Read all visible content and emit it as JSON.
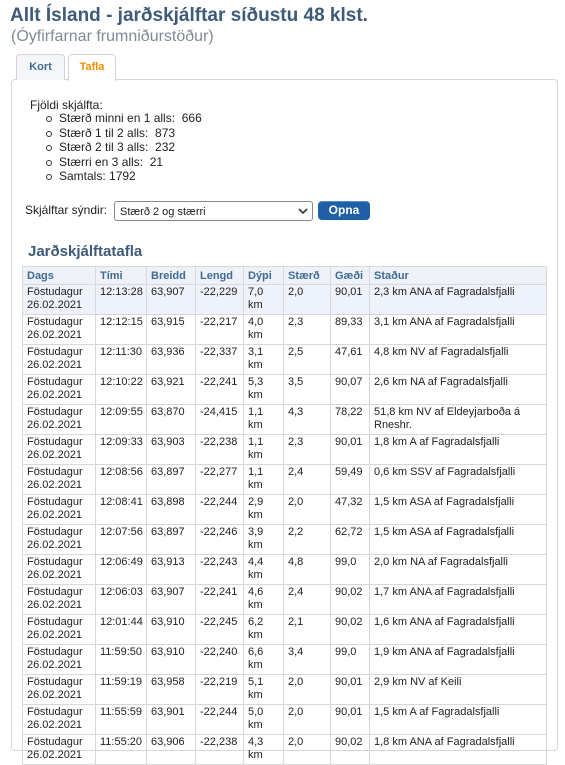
{
  "header": {
    "title": "Allt Ísland - jarðskjálftar síðustu 48 klst.",
    "subtitle": "(Óyfirfarnar frumniðurstöður)"
  },
  "tabs": [
    {
      "label": "Kort",
      "active": false
    },
    {
      "label": "Tafla",
      "active": true
    }
  ],
  "counts": {
    "title": "Fjöldi skjálfta:",
    "items": [
      {
        "label": "Stærð minni en 1 alls:  666"
      },
      {
        "label": "Stærð 1 til 2 alls:  873"
      },
      {
        "label": "Stærð 2 til 3 alls:  232"
      },
      {
        "label": "Stærri en 3 alls:  21"
      },
      {
        "label": "Samtals: 1792"
      }
    ]
  },
  "filter": {
    "label": "Skjálftar sýndir:",
    "selected": "Stærð 2 og stærri",
    "button_label": "Opna"
  },
  "table": {
    "title": "Jarðskjálftatafla",
    "columns": [
      "Dags",
      "Tími",
      "Breidd",
      "Lengd",
      "Dýpi",
      "Stærð",
      "Gæði",
      "Staður"
    ],
    "rows": [
      {
        "day": "Föstudagur",
        "date": "26.02.2021",
        "time": "12:13:28",
        "lat": "63,907",
        "lon": "-22,229",
        "depth": "7,0",
        "depth_unit": "km",
        "mag": "2,0",
        "quality": "90,01",
        "place": "2,3 km ANA af Fagradalsfjalli"
      },
      {
        "day": "Föstudagur",
        "date": "26.02.2021",
        "time": "12:12:15",
        "lat": "63,915",
        "lon": "-22,217",
        "depth": "4,0",
        "depth_unit": "km",
        "mag": "2,3",
        "quality": "89,33",
        "place": "3,1 km ANA af Fagradalsfjalli"
      },
      {
        "day": "Föstudagur",
        "date": "26.02.2021",
        "time": "12:11:30",
        "lat": "63,936",
        "lon": "-22,337",
        "depth": "3,1",
        "depth_unit": "km",
        "mag": "2,5",
        "quality": "47,61",
        "place": "4,8 km NV af Fagradalsfjalli"
      },
      {
        "day": "Föstudagur",
        "date": "26.02.2021",
        "time": "12:10:22",
        "lat": "63,921",
        "lon": "-22,241",
        "depth": "5,3",
        "depth_unit": "km",
        "mag": "3,5",
        "quality": "90,07",
        "place": "2,6 km NA af Fagradalsfjalli"
      },
      {
        "day": "Föstudagur",
        "date": "26.02.2021",
        "time": "12:09:55",
        "lat": "63,870",
        "lon": "-24,415",
        "depth": "1,1",
        "depth_unit": "km",
        "mag": "4,3",
        "quality": "78,22",
        "place": "51,8 km NV af Eldeyjarboða á Rneshr."
      },
      {
        "day": "Föstudagur",
        "date": "26.02.2021",
        "time": "12:09:33",
        "lat": "63,903",
        "lon": "-22,238",
        "depth": "1,1",
        "depth_unit": "km",
        "mag": "2,3",
        "quality": "90,01",
        "place": "1,8 km A af Fagradalsfjalli"
      },
      {
        "day": "Föstudagur",
        "date": "26.02.2021",
        "time": "12:08:56",
        "lat": "63,897",
        "lon": "-22,277",
        "depth": "1,1",
        "depth_unit": "km",
        "mag": "2,4",
        "quality": "59,49",
        "place": "0,6 km SSV af Fagradalsfjalli"
      },
      {
        "day": "Föstudagur",
        "date": "26.02.2021",
        "time": "12:08:41",
        "lat": "63,898",
        "lon": "-22,244",
        "depth": "2,9",
        "depth_unit": "km",
        "mag": "2,0",
        "quality": "47,32",
        "place": "1,5 km ASA af Fagradalsfjalli"
      },
      {
        "day": "Föstudagur",
        "date": "26.02.2021",
        "time": "12:07:56",
        "lat": "63,897",
        "lon": "-22,246",
        "depth": "3,9",
        "depth_unit": "km",
        "mag": "2,2",
        "quality": "62,72",
        "place": "1,5 km ASA af Fagradalsfjalli"
      },
      {
        "day": "Föstudagur",
        "date": "26.02.2021",
        "time": "12:06:49",
        "lat": "63,913",
        "lon": "-22,243",
        "depth": "4,4",
        "depth_unit": "km",
        "mag": "4,8",
        "quality": "99,0",
        "place": "2,0 km NA af Fagradalsfjalli"
      },
      {
        "day": "Föstudagur",
        "date": "26.02.2021",
        "time": "12:06:03",
        "lat": "63,907",
        "lon": "-22,241",
        "depth": "4,6",
        "depth_unit": "km",
        "mag": "2,4",
        "quality": "90,02",
        "place": "1,7 km ANA af Fagradalsfjalli"
      },
      {
        "day": "Föstudagur",
        "date": "26.02.2021",
        "time": "12:01:44",
        "lat": "63,910",
        "lon": "-22,245",
        "depth": "6,2",
        "depth_unit": "km",
        "mag": "2,1",
        "quality": "90,02",
        "place": "1,6 km ANA af Fagradalsfjalli"
      },
      {
        "day": "Föstudagur",
        "date": "26.02.2021",
        "time": "11:59:50",
        "lat": "63,910",
        "lon": "-22,240",
        "depth": "6,6",
        "depth_unit": "km",
        "mag": "3,4",
        "quality": "99,0",
        "place": "1,9 km ANA af Fagradalsfjalli"
      },
      {
        "day": "Föstudagur",
        "date": "26.02.2021",
        "time": "11:59:19",
        "lat": "63,958",
        "lon": "-22,219",
        "depth": "5,1",
        "depth_unit": "km",
        "mag": "2,0",
        "quality": "90,01",
        "place": "2,9 km NV af Keili"
      },
      {
        "day": "Föstudagur",
        "date": "26.02.2021",
        "time": "11:55:59",
        "lat": "63,901",
        "lon": "-22,244",
        "depth": "5,0",
        "depth_unit": "km",
        "mag": "2,0",
        "quality": "90,01",
        "place": "1,5 km A af Fagradalsfjalli"
      },
      {
        "day": "Föstudagur",
        "date": "26.02.2021",
        "time": "11:55:20",
        "lat": "63,906",
        "lon": "-22,238",
        "depth": "4,3",
        "depth_unit": "km",
        "mag": "2,0",
        "quality": "90,02",
        "place": "1,8 km ANA af Fagradalsfjalli"
      }
    ]
  }
}
